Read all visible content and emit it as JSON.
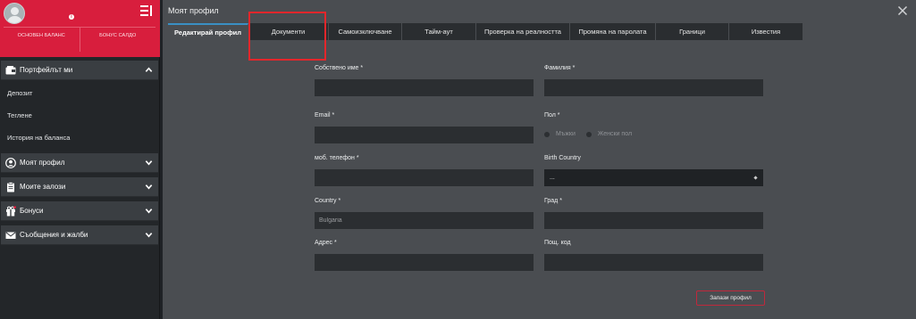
{
  "sidebar": {
    "balances": {
      "main": "ОСНОВЕН БАЛАНС",
      "bonus": "БОНУС САЛДО"
    },
    "portfolio": {
      "label": "Портфейлът ми",
      "items": [
        "Депозит",
        "Теглене",
        "История на баланса"
      ]
    },
    "sections": [
      {
        "label": "Моят профил",
        "icon": "user-circle-icon"
      },
      {
        "label": "Моите залози",
        "icon": "clipboard-icon"
      },
      {
        "label": "Бонуси",
        "icon": "gift-icon"
      },
      {
        "label": "Съобщения и жалби",
        "icon": "envelope-icon"
      }
    ]
  },
  "main": {
    "title": "Моят профил",
    "tabs": [
      "Редактирай профил",
      "Документи",
      "Самоизключване",
      "Тайм-аут",
      "Проверка на реалността",
      "Промяна на паролата",
      "Граници",
      "Известия"
    ],
    "active_tab": "Редактирай профил",
    "form": {
      "first_name": {
        "label": "Собствено име *",
        "value": ""
      },
      "last_name": {
        "label": "Фамилия *",
        "value": ""
      },
      "email": {
        "label": "Email *",
        "value": ""
      },
      "gender": {
        "label": "Пол *",
        "options": [
          "Мъжки",
          "Женски пол"
        ]
      },
      "phone": {
        "label": "моб. телефон *",
        "value": ""
      },
      "birth_country": {
        "label": "Birth Country",
        "value": "..."
      },
      "country": {
        "label": "Country *",
        "placeholder": "Bulgaria"
      },
      "city": {
        "label": "Град *",
        "value": ""
      },
      "address": {
        "label": "Адрес *",
        "value": ""
      },
      "postal_code": {
        "label": "Пощ. код",
        "value": ""
      }
    },
    "save_label": "Запази профил"
  },
  "colors": {
    "brand_red": "#d81e3d",
    "highlight": "#e3262b",
    "tab_accent": "#3a8fc4"
  }
}
